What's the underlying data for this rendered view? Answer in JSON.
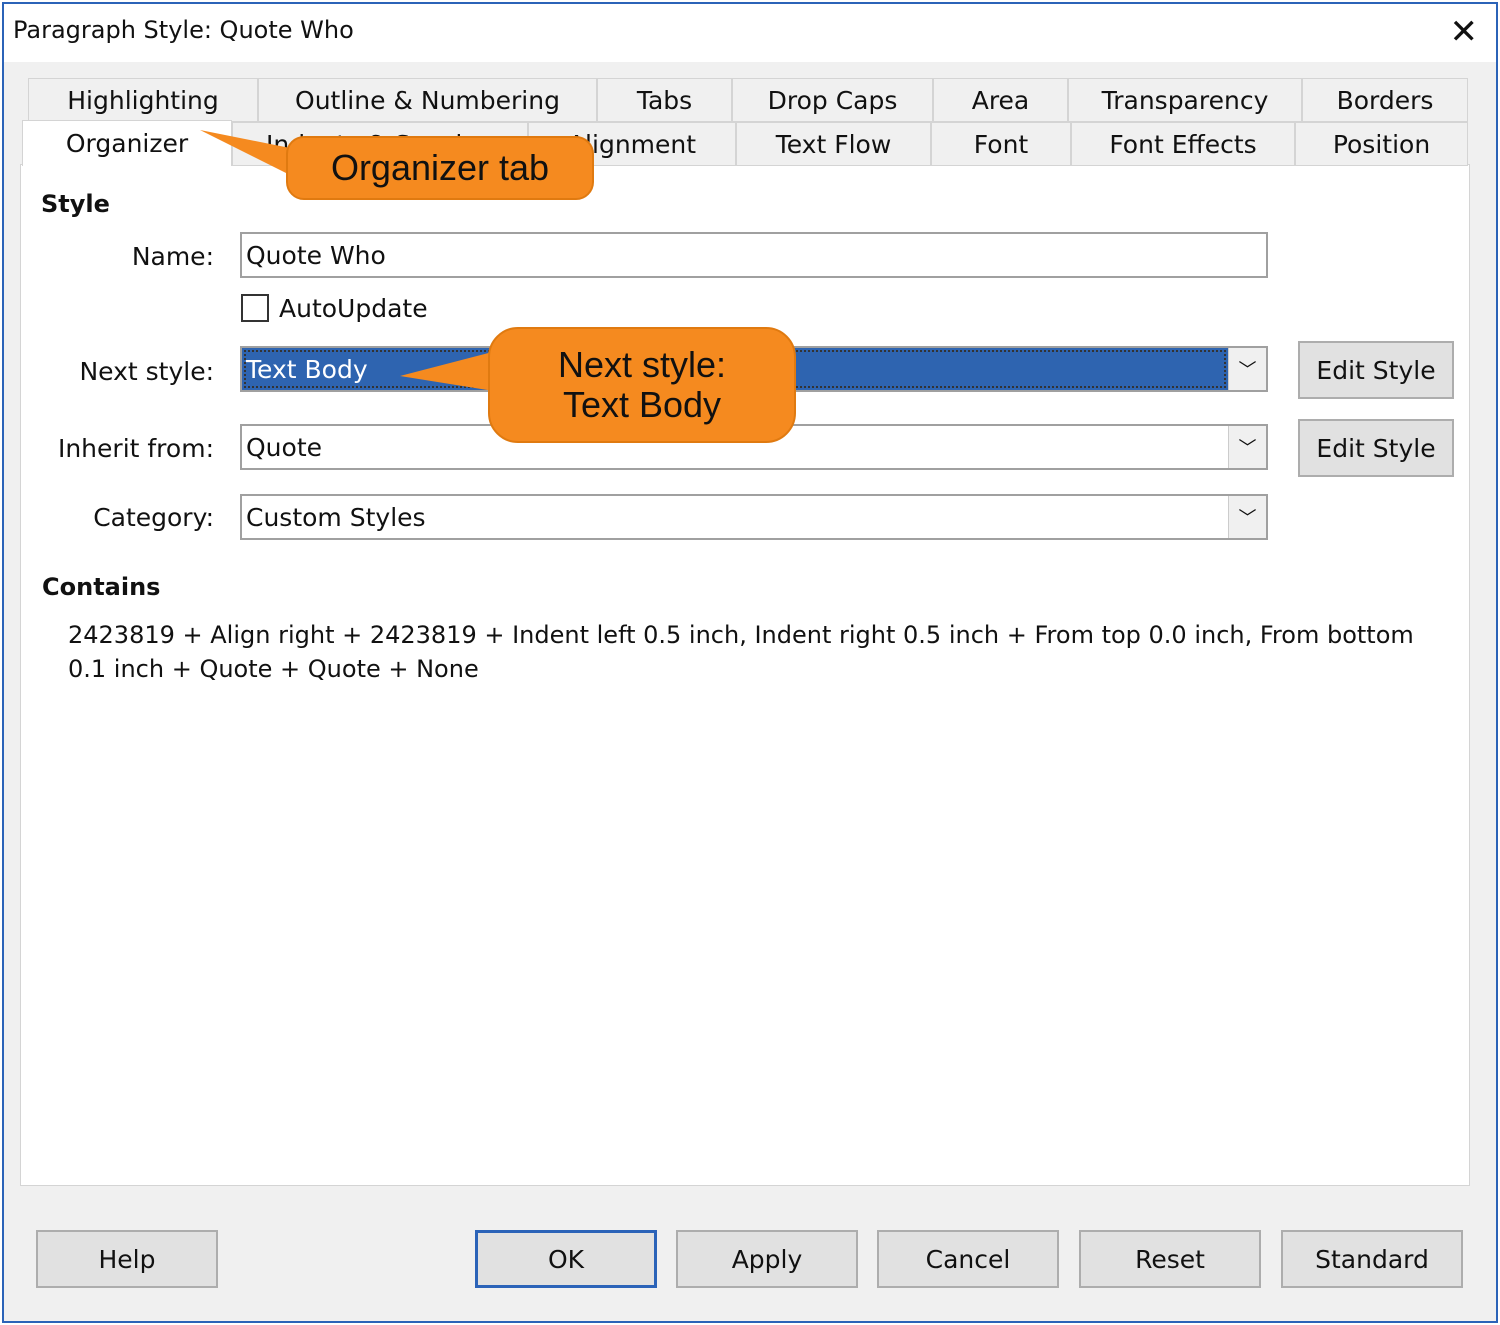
{
  "window": {
    "title": "Paragraph Style: Quote Who",
    "close_icon": "close-icon"
  },
  "tabs": {
    "row1": [
      "Highlighting",
      "Outline & Numbering",
      "Tabs",
      "Drop Caps",
      "Area",
      "Transparency",
      "Borders"
    ],
    "row2": [
      "Organizer",
      "Indents & Spacing",
      "Alignment",
      "Text Flow",
      "Font",
      "Font Effects",
      "Position"
    ],
    "active": "Organizer"
  },
  "style": {
    "heading": "Style",
    "name_label": "Name:",
    "name_value": "Quote Who",
    "autoupdate_label": "AutoUpdate",
    "autoupdate_checked": false,
    "next_label": "Next style:",
    "next_value": "Text Body",
    "inherit_label": "Inherit from:",
    "inherit_value": "Quote",
    "category_label": "Category:",
    "category_value": "Custom Styles",
    "edit_style": "Edit Style"
  },
  "contains": {
    "heading": "Contains",
    "text": "2423819 + Align right + 2423819 + Indent left 0.5 inch, Indent right 0.5 inch + From top 0.0 inch, From bottom 0.1 inch + Quote + Quote + None"
  },
  "buttons": {
    "help": "Help",
    "ok": "OK",
    "apply": "Apply",
    "cancel": "Cancel",
    "reset": "Reset",
    "standard": "Standard"
  },
  "callouts": {
    "organizer": "Organizer tab",
    "next_style": "Next style:\nText Body"
  },
  "colors": {
    "accent": "#2e64b0",
    "callout": "#f58a1f"
  }
}
